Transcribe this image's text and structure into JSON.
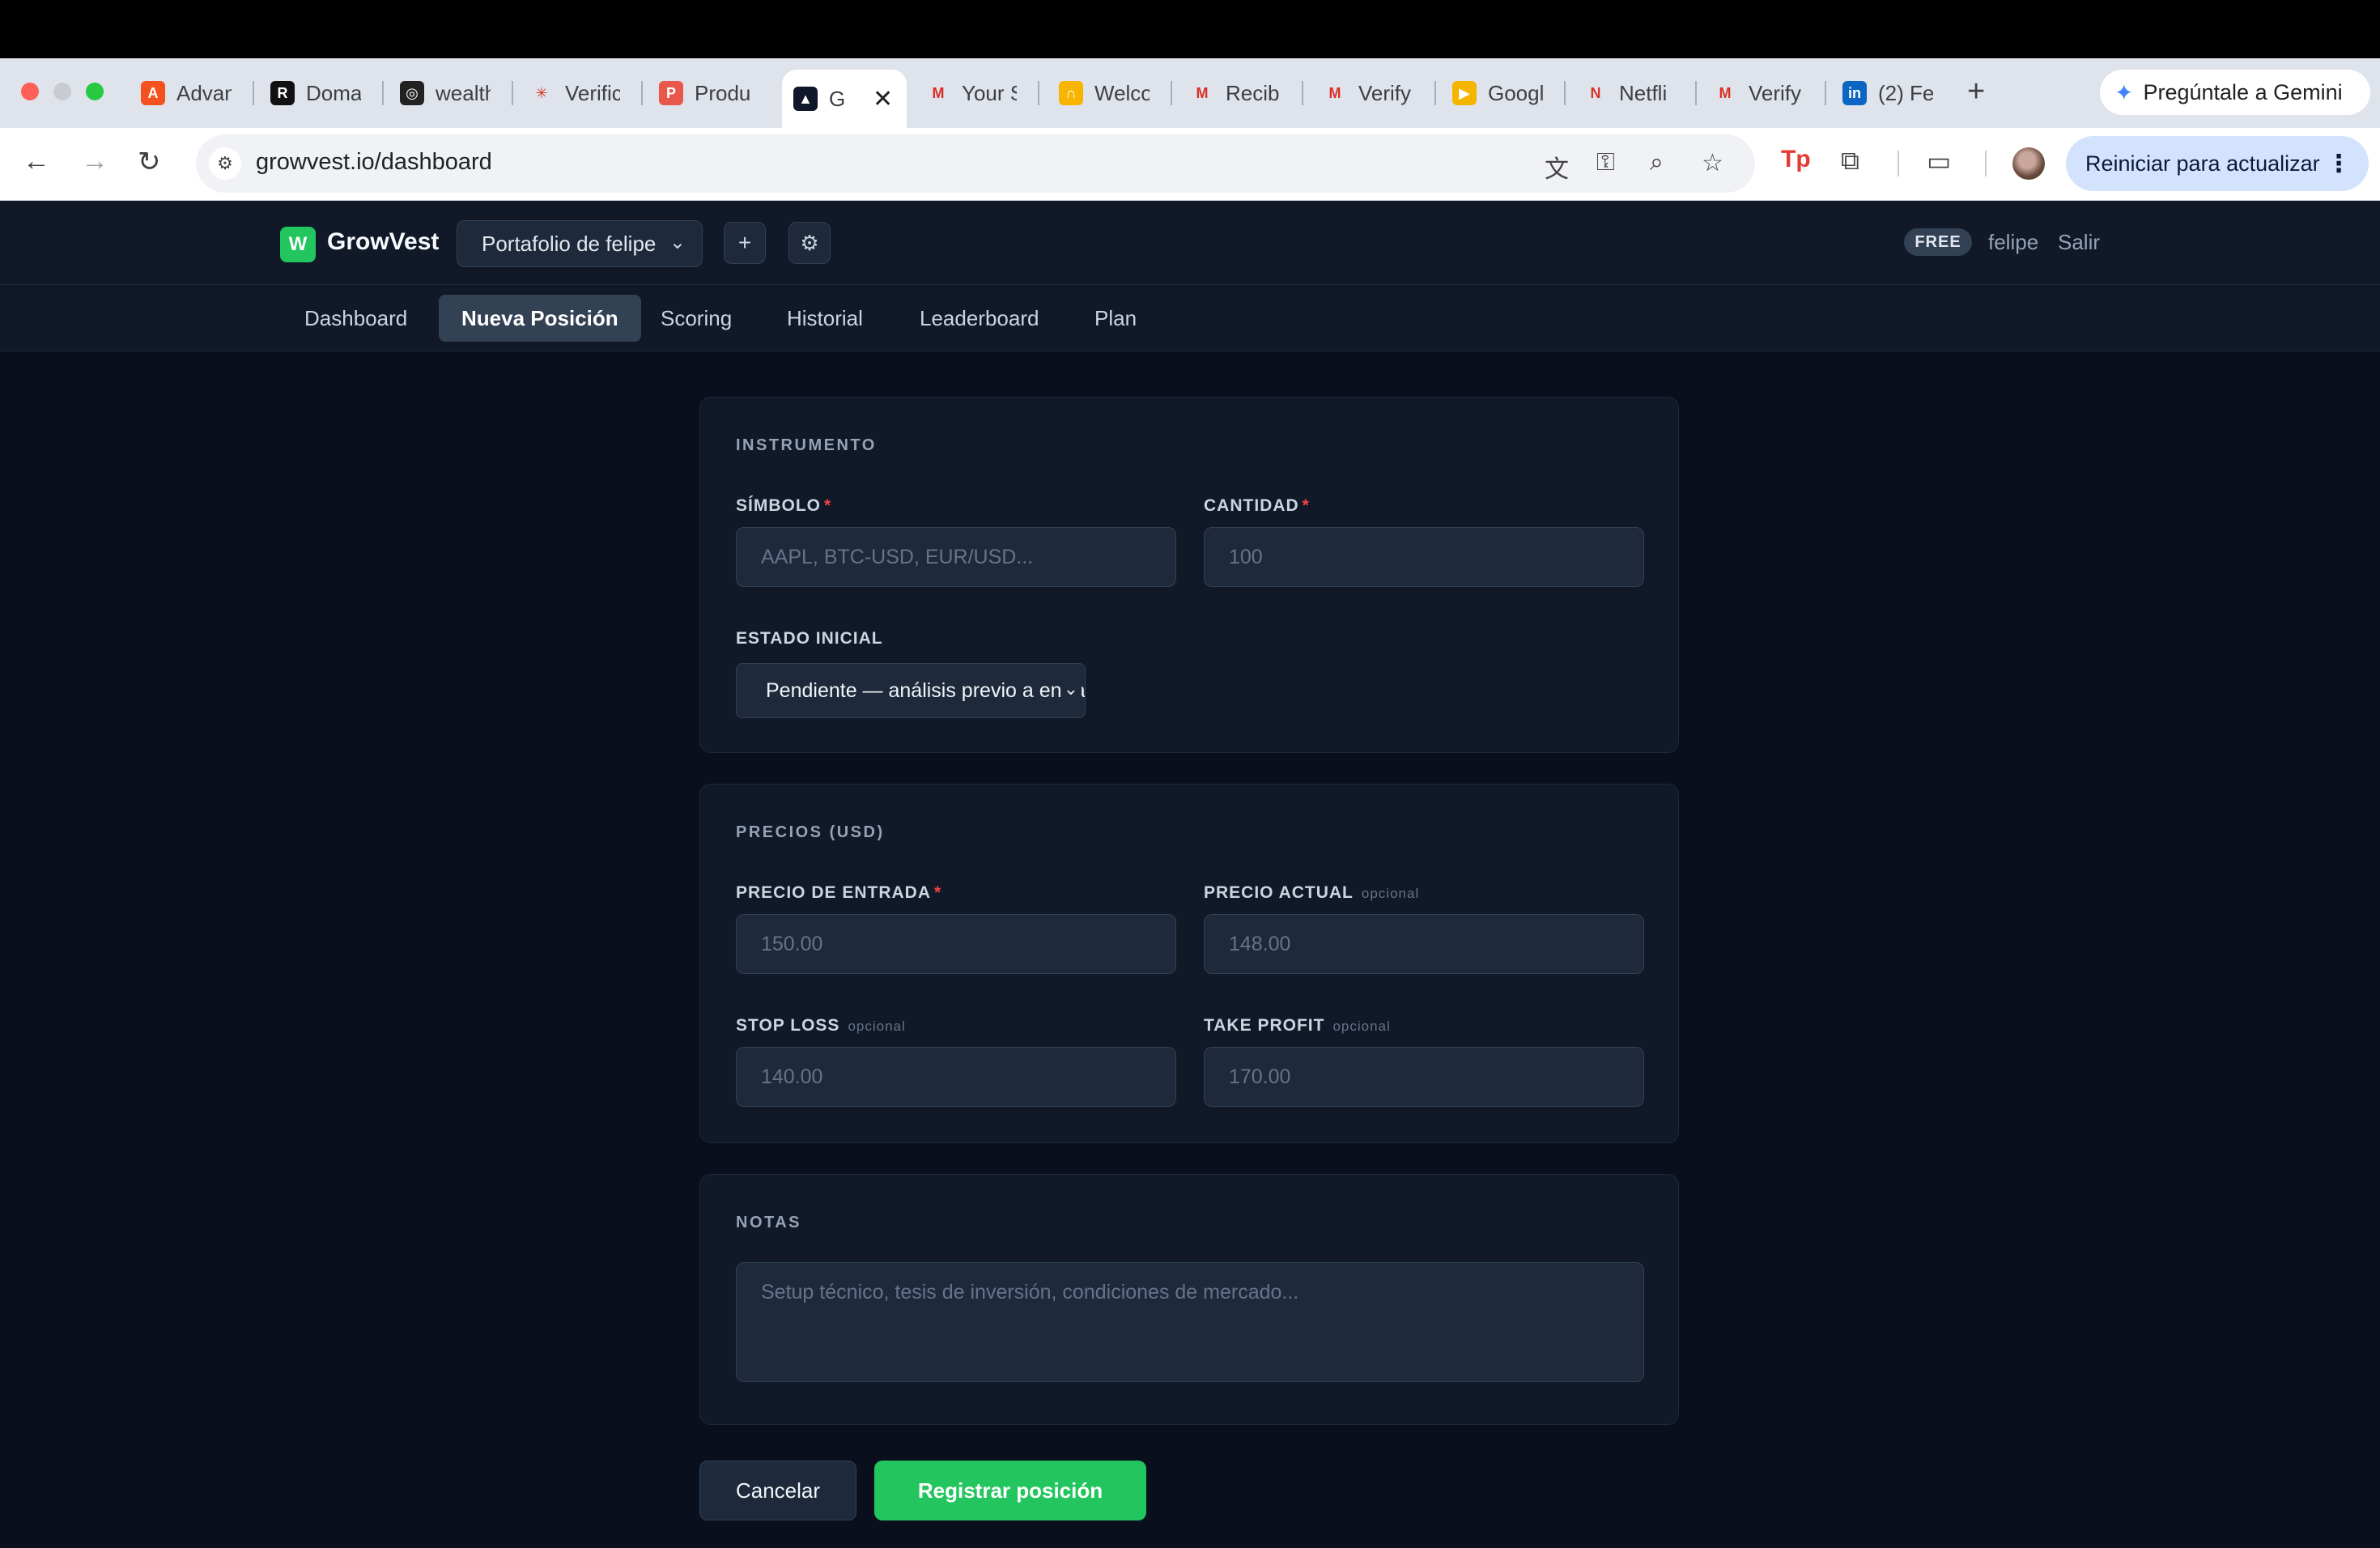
{
  "browser": {
    "tabs": [
      {
        "label": "Advan",
        "icon": "A",
        "color": "#f4511e"
      },
      {
        "label": "Doma",
        "icon": "R",
        "color": "#111111"
      },
      {
        "label": "wealth",
        "icon": "◎",
        "color": "#222222"
      },
      {
        "label": "Verific",
        "icon": "✳",
        "color": "#dfe3eb"
      },
      {
        "label": "Produ",
        "icon": "P",
        "color": "#e8574a"
      },
      {
        "label": "Gr",
        "icon": "▲",
        "color": "#0f172a"
      },
      {
        "label": "Your S",
        "icon": "M",
        "color": "#dfe3eb"
      },
      {
        "label": "Welco",
        "icon": "∩",
        "color": "#f7b500"
      },
      {
        "label": "Recibi",
        "icon": "M",
        "color": "#dfe3eb"
      },
      {
        "label": "Verify",
        "icon": "M",
        "color": "#dfe3eb"
      },
      {
        "label": "Googl",
        "icon": "▶",
        "color": "#f4b400"
      },
      {
        "label": "Netfli",
        "icon": "N",
        "color": "#dfe3eb"
      },
      {
        "label": "Verify",
        "icon": "M",
        "color": "#dfe3eb"
      },
      {
        "label": "(2) Fe",
        "icon": "in",
        "color": "#0a66c2"
      }
    ],
    "gemini_label": "Pregúntale a Gemini",
    "url": "growvest.io/dashboard",
    "update_label": "Reiniciar para actualizar"
  },
  "app": {
    "logo_letter": "W",
    "name": "GrowVest",
    "portfolio": "Portafolio de felipe",
    "plan_badge": "FREE",
    "user": "felipe",
    "logout": "Salir",
    "nav": [
      "Dashboard",
      "Nueva Posición",
      "Scoring",
      "Historial",
      "Leaderboard",
      "Plan"
    ],
    "active_nav": "Nueva Posición"
  },
  "form": {
    "instrument": {
      "title": "INSTRUMENTO",
      "symbol_label": "SÍMBOLO",
      "symbol_placeholder": "AAPL, BTC-USD, EUR/USD...",
      "qty_label": "CANTIDAD",
      "qty_placeholder": "100",
      "state_label": "ESTADO INICIAL",
      "state_value": "Pendiente — análisis previo a entrada"
    },
    "prices": {
      "title": "PRECIOS (USD)",
      "entry_label": "PRECIO DE ENTRADA",
      "entry_placeholder": "150.00",
      "current_label": "PRECIO ACTUAL",
      "current_placeholder": "148.00",
      "stop_label": "STOP LOSS",
      "stop_placeholder": "140.00",
      "tp_label": "TAKE PROFIT",
      "tp_placeholder": "170.00",
      "optional": "opcional",
      "required_mark": "*"
    },
    "notes": {
      "title": "NOTAS",
      "placeholder": "Setup técnico, tesis de inversión, condiciones de mercado..."
    },
    "cancel": "Cancelar",
    "submit": "Registrar posición"
  }
}
